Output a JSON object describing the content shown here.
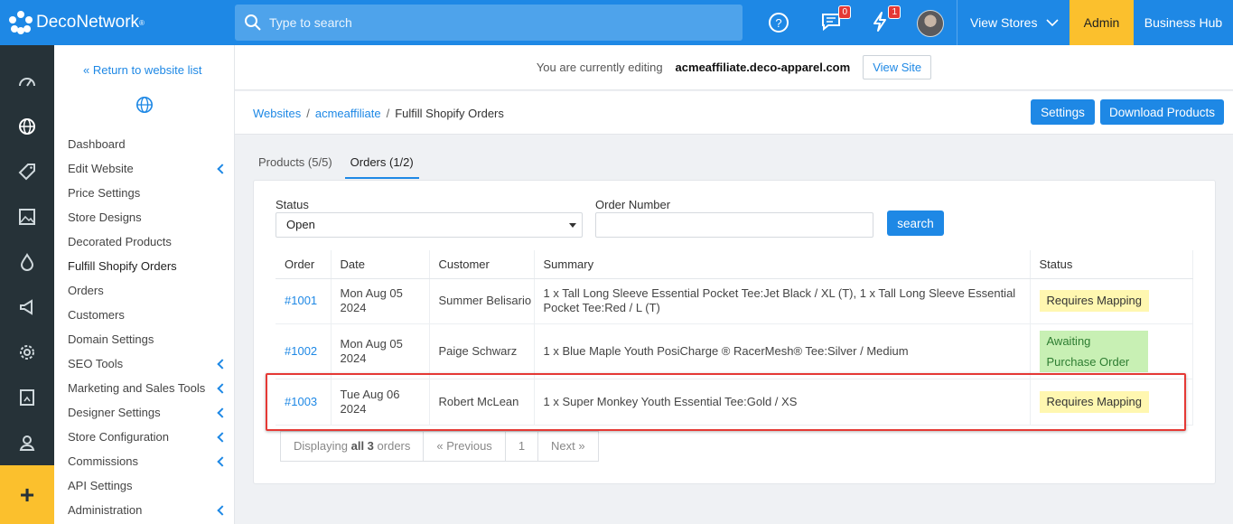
{
  "topbar": {
    "brand": "DecoNetwork",
    "search_placeholder": "Type to search",
    "messages_count": "0",
    "alerts_count": "1",
    "view_stores": "View Stores",
    "admin": "Admin",
    "business_hub": "Business Hub"
  },
  "sidebar": {
    "back_link": "« Return to website list",
    "items": [
      {
        "label": "Dashboard"
      },
      {
        "label": "Edit Website"
      },
      {
        "label": "Price Settings"
      },
      {
        "label": "Store Designs"
      },
      {
        "label": "Decorated Products"
      },
      {
        "label": "Fulfill Shopify Orders"
      },
      {
        "label": "Orders"
      },
      {
        "label": "Customers"
      },
      {
        "label": "Domain Settings"
      },
      {
        "label": "SEO Tools"
      },
      {
        "label": "Marketing and Sales Tools"
      },
      {
        "label": "Designer Settings"
      },
      {
        "label": "Store Configuration"
      },
      {
        "label": "Commissions"
      },
      {
        "label": "API Settings"
      },
      {
        "label": "Administration"
      }
    ]
  },
  "editing": {
    "prefix": "You are currently editing",
    "site": "acmeaffiliate.deco-apparel.com",
    "view_site": "View Site"
  },
  "breadcrumb": {
    "root": "Websites",
    "site": "acmeaffiliate",
    "current": "Fulfill Shopify Orders"
  },
  "actions": {
    "settings": "Settings",
    "download_products": "Download Products"
  },
  "tabs": {
    "products": "Products (5/5)",
    "orders": "Orders (1/2)"
  },
  "filters": {
    "status_label": "Status",
    "status_value": "Open",
    "order_number_label": "Order Number",
    "search_button": "search"
  },
  "table": {
    "headers": {
      "order": "Order",
      "date": "Date",
      "customer": "Customer",
      "summary": "Summary",
      "status": "Status"
    },
    "rows": [
      {
        "order": "#1001",
        "date": "Mon Aug 05 2024",
        "customer": "Summer Belisario",
        "summary": "1 x Tall Long Sleeve Essential Pocket Tee:Jet Black / XL (T), 1 x Tall Long Sleeve Essential Pocket Tee:Red / L (T)",
        "status": "Requires Mapping"
      },
      {
        "order": "#1002",
        "date": "Mon Aug 05 2024",
        "customer": "Paige Schwarz",
        "summary": "1 x Blue Maple Youth PosiCharge ® RacerMesh® Tee:Silver / Medium",
        "status": "Awaiting Purchase Order"
      },
      {
        "order": "#1003",
        "date": "Tue Aug 06 2024",
        "customer": "Robert McLean",
        "summary": "1 x Super Monkey Youth Essential Tee:Gold / XS",
        "status": "Requires Mapping"
      }
    ]
  },
  "pager": {
    "display_prefix": "Displaying",
    "display_all": "all 3",
    "display_suffix": "orders",
    "previous": "« Previous",
    "page": "1",
    "next": "Next »"
  }
}
